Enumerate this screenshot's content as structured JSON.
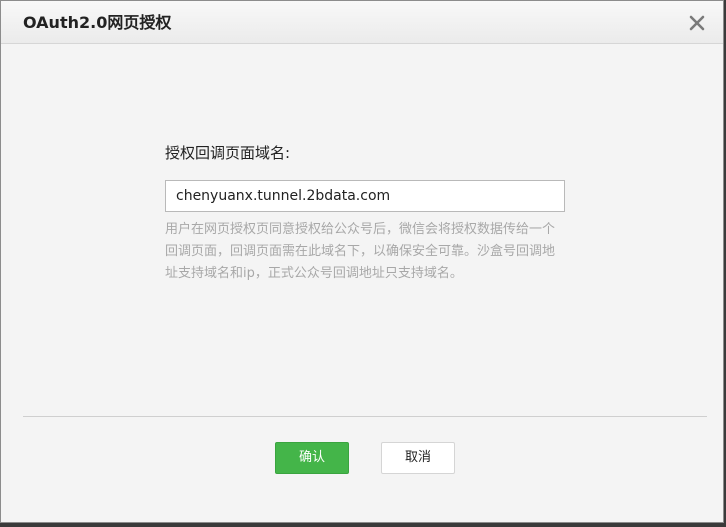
{
  "dialog": {
    "title": "OAuth2.0网页授权"
  },
  "form": {
    "label": "授权回调页面域名:",
    "domain_value": "chenyuanx.tunnel.2bdata.com",
    "hint": "用户在网页授权页同意授权给公众号后，微信会将授权数据传给一个回调页面，回调页面需在此域名下，以确保安全可靠。沙盒号回调地址支持域名和ip，正式公众号回调地址只支持域名。"
  },
  "buttons": {
    "confirm_label": "确认",
    "cancel_label": "取消"
  },
  "icons": {
    "close": "close-icon"
  },
  "colors": {
    "confirm_green": "#44b549"
  }
}
